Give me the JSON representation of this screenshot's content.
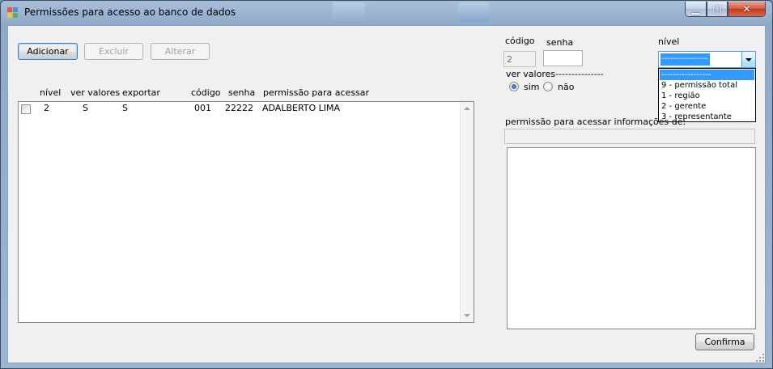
{
  "window": {
    "title": "Permissões para acesso ao banco de dados",
    "minimize_glyph": "▁",
    "maximize_glyph": "▢",
    "close_glyph": "✕"
  },
  "toolbar": {
    "add_label": "Adicionar",
    "delete_label": "Excluir",
    "edit_label": "Alterar"
  },
  "list": {
    "columns": [
      "nível",
      "ver valores",
      "exportar",
      "código",
      "senha",
      "permissão para acessar"
    ],
    "rows": [
      {
        "checked": false,
        "nivel": "2",
        "ver_valores": "S",
        "exportar": "S",
        "codigo": "001",
        "senha": "22222",
        "permissao": "ADALBERTO LIMA"
      }
    ]
  },
  "form": {
    "codigo_label": "código",
    "codigo_value": "2",
    "senha_label": "senha",
    "senha_value": "",
    "nivel_label": "nível",
    "nivel_selected": "-----------------",
    "nivel_options": [
      "-----------------",
      "9 - permissão total",
      "1 - região",
      "2 - gerente",
      "3 - representante"
    ],
    "ver_valores_label": "ver valores---------------",
    "ver_valores_options": [
      {
        "label": "sim",
        "selected": true
      },
      {
        "label": "não",
        "selected": false
      }
    ],
    "perm_info_label": "permissão para acessar informações de:",
    "perm_info_value": "",
    "confirm_label": "Confirma"
  },
  "colors": {
    "selection": "#3399ff",
    "titlebar": "#a9c0da",
    "close_button": "#c23a1d"
  },
  "icons": [
    "app-icon",
    "minimize-icon",
    "maximize-icon",
    "close-icon",
    "scroll-up-icon",
    "scroll-down-icon",
    "dropdown-arrow-icon",
    "resize-grip-icon"
  ]
}
